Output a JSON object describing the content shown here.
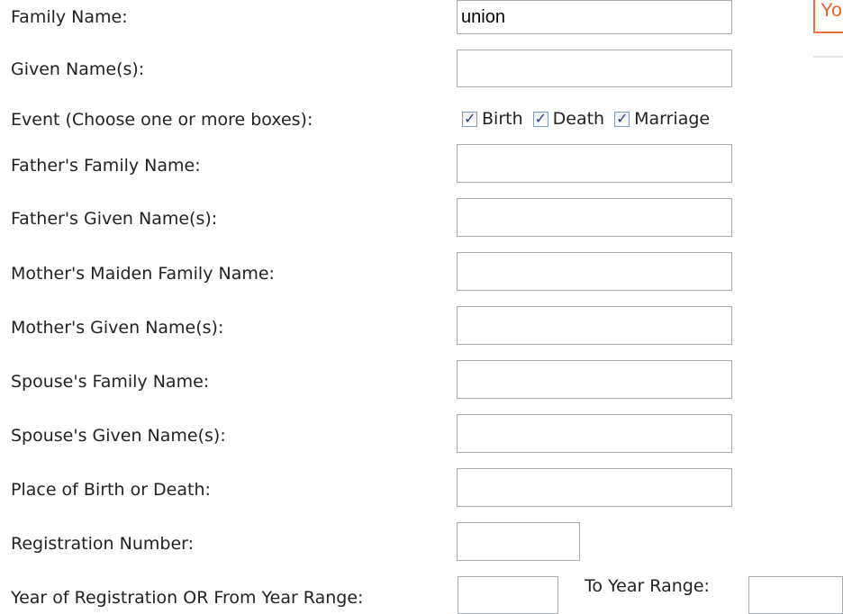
{
  "form": {
    "family_name": {
      "label": "Family Name:",
      "value": "union"
    },
    "given_names": {
      "label": "Given Name(s):",
      "value": ""
    },
    "event": {
      "label": "Event (Choose one or more boxes):",
      "options": [
        {
          "label": "Birth",
          "checked": true
        },
        {
          "label": "Death",
          "checked": true
        },
        {
          "label": "Marriage",
          "checked": true
        }
      ]
    },
    "father_family_name": {
      "label": "Father's Family Name:",
      "value": ""
    },
    "father_given_names": {
      "label": "Father's Given Name(s):",
      "value": ""
    },
    "mother_maiden_name": {
      "label": "Mother's Maiden Family Name:",
      "value": ""
    },
    "mother_given_names": {
      "label": "Mother's Given Name(s):",
      "value": ""
    },
    "spouse_family_name": {
      "label": "Spouse's Family Name:",
      "value": ""
    },
    "spouse_given_names": {
      "label": "Spouse's Given Name(s):",
      "value": ""
    },
    "place": {
      "label": "Place of Birth or Death:",
      "value": ""
    },
    "registration_number": {
      "label": "Registration Number:",
      "value": ""
    },
    "year_from": {
      "label": "Year of Registration OR From Year Range:",
      "value": ""
    },
    "year_to": {
      "label": "To Year Range:",
      "value": ""
    }
  },
  "side_alert": {
    "text": "Yo"
  },
  "colors": {
    "accent_red": "#d81f26",
    "alert_orange": "#e8703c",
    "checkbox_check": "#243c8a"
  }
}
